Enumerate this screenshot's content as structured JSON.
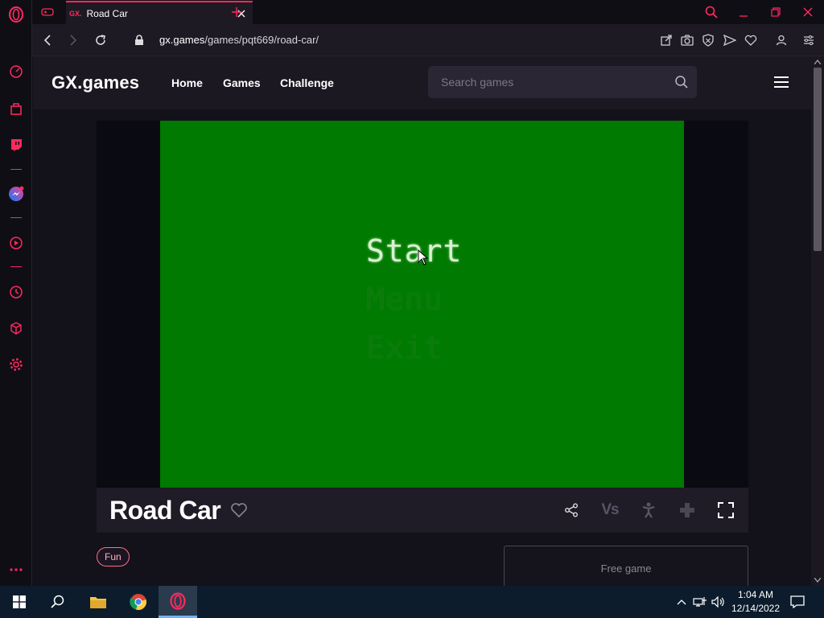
{
  "browser": {
    "tab": {
      "favicon_text": "GX.",
      "title": "Road Car"
    },
    "url": {
      "host": "gx.games",
      "path": "/games/pqt669/road-car/"
    }
  },
  "site": {
    "logo": "GX.games",
    "nav": [
      "Home",
      "Games",
      "Challenge"
    ],
    "search_placeholder": "Search games"
  },
  "game": {
    "menu_options": [
      "Start",
      "Menu",
      "Exit"
    ],
    "title": "Road Car",
    "tag": "Fun",
    "free_label": "Free game",
    "vs_label": "Vs",
    "canvas_color": "#007a00"
  },
  "taskbar": {
    "time": "1:04 AM",
    "date": "12/14/2022"
  },
  "colors": {
    "accent": "#ff2a5e",
    "header_bg": "#1b1822"
  }
}
